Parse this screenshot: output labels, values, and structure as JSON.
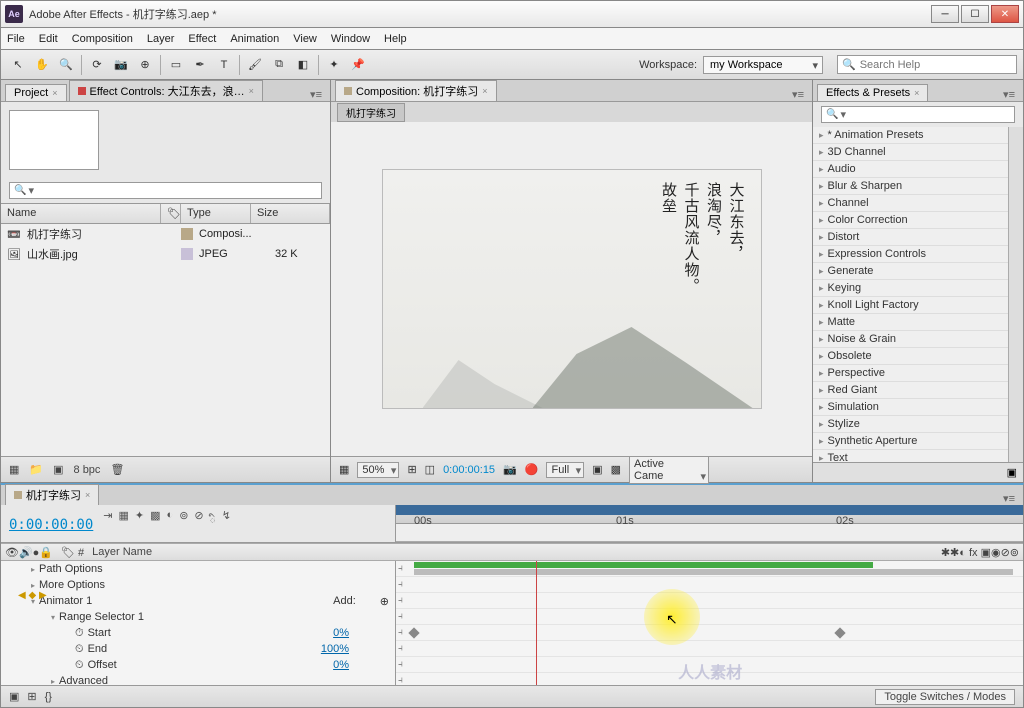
{
  "window": {
    "title": "Adobe After Effects - 机打字练习.aep *"
  },
  "menu": [
    "File",
    "Edit",
    "Composition",
    "Layer",
    "Effect",
    "Animation",
    "View",
    "Window",
    "Help"
  ],
  "workspace": {
    "label": "Workspace:",
    "value": "my Workspace"
  },
  "search_help": {
    "placeholder": "Search Help"
  },
  "project": {
    "tab": "Project",
    "fx_tab": "Effect Controls: 大江东去，浪…",
    "columns": {
      "name": "Name",
      "type": "Type",
      "size": "Size"
    },
    "rows": [
      {
        "icon": "📼",
        "name": "机打字练习",
        "type": "Composi...",
        "size": ""
      },
      {
        "icon": "🖼",
        "name": "山水画.jpg",
        "type": "JPEG",
        "size": "32 K"
      }
    ],
    "footer": {
      "bpc": "8 bpc"
    }
  },
  "composition": {
    "tab": "Composition: 机打字练习",
    "subtab": "机打字练习",
    "poetry": "大江东去，\n浪淘尽，\n千古风流人物。\n故垒",
    "footer": {
      "zoom": "50%",
      "time": "0:00:00:15",
      "res": "Full",
      "camera": "Active Came"
    }
  },
  "effects": {
    "tab": "Effects & Presets",
    "items": [
      "* Animation Presets",
      "3D Channel",
      "Audio",
      "Blur & Sharpen",
      "Channel",
      "Color Correction",
      "Distort",
      "Expression Controls",
      "Generate",
      "Keying",
      "Knoll Light Factory",
      "Matte",
      "Noise & Grain",
      "Obsolete",
      "Perspective",
      "Red Giant",
      "Simulation",
      "Stylize",
      "Synthetic Aperture",
      "Text"
    ]
  },
  "timeline": {
    "tab": "机打字练习",
    "timecode": "0:00:00:00",
    "col_layer": "Layer Name",
    "ruler": {
      "t0": "00s",
      "t1": "01s",
      "t2": "02s"
    },
    "rows": {
      "path_options": "Path Options",
      "more_options": "More Options",
      "animator": "Animator 1",
      "add": "Add:",
      "range": "Range Selector 1",
      "start": "Start",
      "start_v": "0%",
      "end": "End",
      "end_v": "100%",
      "offset": "Offset",
      "offset_v": "0%",
      "advanced": "Advanced"
    },
    "toggle": "Toggle Switches / Modes"
  },
  "watermark": "人人素材"
}
